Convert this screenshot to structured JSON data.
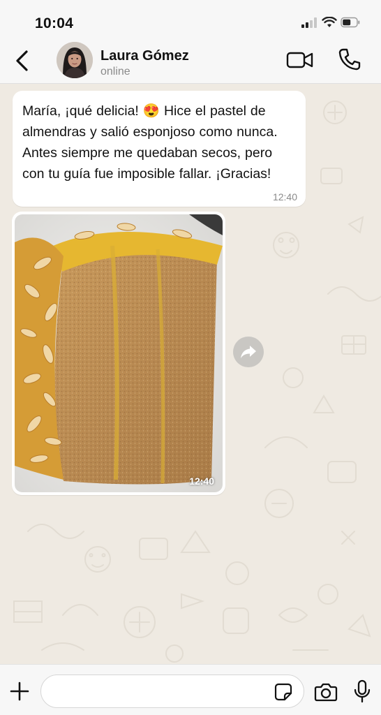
{
  "status_bar": {
    "time": "10:04"
  },
  "header": {
    "contact_name": "Laura Gómez",
    "contact_status": "online",
    "icons": [
      "back-arrow-icon",
      "video-camera-icon",
      "phone-icon"
    ]
  },
  "messages": [
    {
      "type": "text",
      "text": "María, ¡qué delicia! 😍 Hice el pastel de almendras y salió esponjoso como nunca. Antes siempre me quedaban secos, pero con tu guía fue imposible fallar. ¡Gracias!",
      "time": "12:40"
    },
    {
      "type": "image",
      "subject": "slice of almond cake",
      "time": "12:40"
    }
  ],
  "input_bar": {
    "value": "",
    "icons": [
      "plus-icon",
      "sticker-icon",
      "camera-icon",
      "microphone-icon"
    ]
  },
  "colors": {
    "chat_background": "#efeae2",
    "bar_background": "#f7f7f7",
    "bubble_background": "#ffffff",
    "secondary_text": "#8a8a8a"
  }
}
